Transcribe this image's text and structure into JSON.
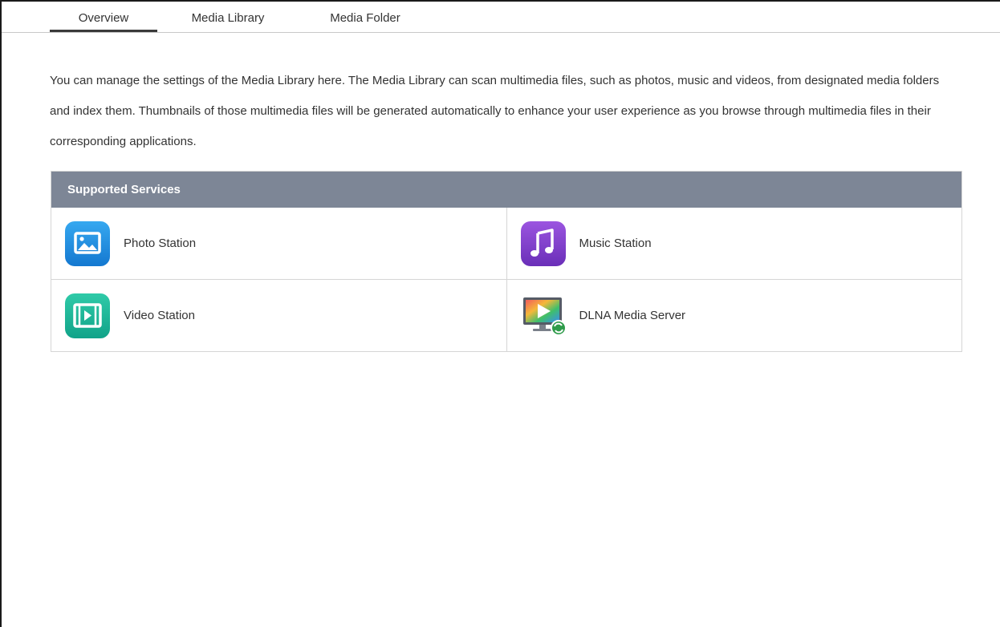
{
  "tabs": [
    {
      "label": "Overview",
      "active": true
    },
    {
      "label": "Media Library",
      "active": false
    },
    {
      "label": "Media Folder",
      "active": false
    }
  ],
  "description": "You can manage the settings of the Media Library here. The Media Library can scan multimedia files, such as photos, music and videos, from designated media folders and index them. Thumbnails of those multimedia files will be generated automatically to enhance your user experience as you browse through multimedia files in their corresponding applications.",
  "services": {
    "title": "Supported Services",
    "header_color": "#7d8696",
    "items": [
      {
        "label": "Photo Station",
        "icon": "photo-station-icon",
        "color": "#1e8fe0"
      },
      {
        "label": "Music Station",
        "icon": "music-station-icon",
        "color": "#7b3fc9"
      },
      {
        "label": "Video Station",
        "icon": "video-station-icon",
        "color": "#1cb79a"
      },
      {
        "label": "DLNA Media Server",
        "icon": "dlna-media-server-icon",
        "color": "#2e9b4a"
      }
    ]
  }
}
